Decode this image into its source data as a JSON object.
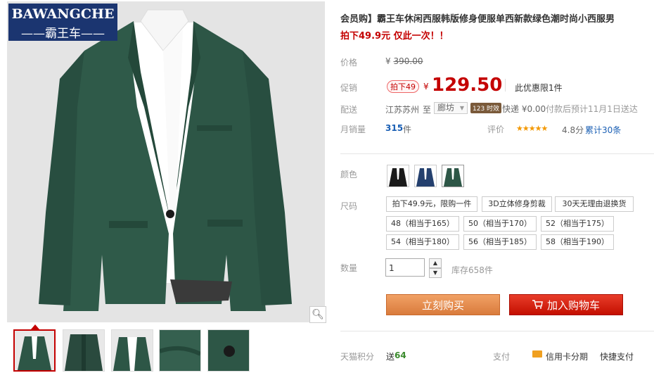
{
  "brand": {
    "logo_en": "BAWANGCHE",
    "logo_cn": "——霸王车——"
  },
  "product": {
    "title": "会员购】霸王车休闲西服韩版修身便服单西新款绿色潮时尚小西服男",
    "subtitle": "拍下49.9元 仅此一次！！"
  },
  "price": {
    "label": "价格",
    "currency": "¥",
    "original": "390.00",
    "promo_label": "促销",
    "promo_tag": "拍下49",
    "promo_value": "129.50",
    "promo_note": "此优惠限1件"
  },
  "shipping": {
    "label": "配送",
    "from": "江苏苏州",
    "to_word": "至",
    "to": "廊坊",
    "badge": "123 时效",
    "fee": "快递 ¥0.00",
    "eta": "付款后预计11月1日送达"
  },
  "sales": {
    "label": "月销量",
    "count": "315",
    "unit": "件",
    "rating_label": "评价",
    "stars": "★★★★★",
    "score": "4.8分",
    "total": "累计30条"
  },
  "color": {
    "label": "颜色",
    "options": [
      "black-jacket",
      "blue-jacket",
      "green-jacket"
    ]
  },
  "size": {
    "label": "尺码",
    "tags": [
      "拍下49.9元，限购一件",
      "3D立体修身剪裁",
      "30天无理由退换货"
    ],
    "options": [
      "48（相当于165）",
      "50（相当于170）",
      "52（相当于175）",
      "54（相当于180）",
      "56（相当于185）",
      "58（相当于190）"
    ]
  },
  "quantity": {
    "label": "数量",
    "value": "1",
    "stock": "库存658件"
  },
  "actions": {
    "buy": "立刻购买",
    "cart": "加入购物车"
  },
  "footer": {
    "points_label": "天猫积分",
    "points_prefix": "送",
    "points": "64",
    "pay_label": "支付",
    "credit": "信用卡分期",
    "quick": "快捷支付"
  },
  "colors": {
    "accent": "#c40000",
    "buy": "#e5925c",
    "cart": "#c40f00",
    "logo_bg": "#1b3570",
    "jacket": "#2d5646"
  }
}
